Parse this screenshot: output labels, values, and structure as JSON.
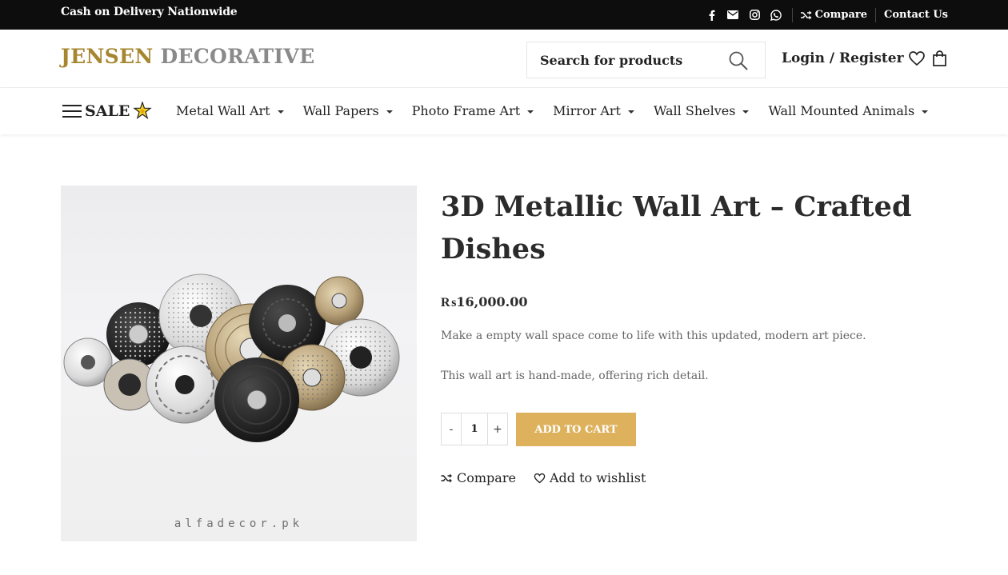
{
  "topbar": {
    "promo": "Cash on Delivery Nationwide",
    "social_icons": [
      "facebook-icon",
      "envelope-icon",
      "instagram-icon",
      "whatsapp-icon"
    ],
    "compare_label": "Compare",
    "contact_label": "Contact Us"
  },
  "header": {
    "logo_part1": "JENSEN",
    "logo_part2": "DECORATIVE",
    "search_placeholder": "Search for products",
    "login_label": "Login / Register"
  },
  "nav": {
    "sale_label": "SALE",
    "items": [
      {
        "label": "Metal Wall Art"
      },
      {
        "label": "Wall Papers"
      },
      {
        "label": "Photo Frame Art"
      },
      {
        "label": "Mirror Art"
      },
      {
        "label": "Wall Shelves"
      },
      {
        "label": "Wall Mounted Animals"
      }
    ]
  },
  "product": {
    "title": "3D Metallic Wall Art – Crafted Dishes",
    "price": "₨16,000.00",
    "desc1": "Make a empty wall space come to life with this updated, modern art piece.",
    "desc2": "This wall art is hand-made, offering rich detail.",
    "image_watermark": "alfadecor.pk",
    "qty_minus": "-",
    "qty_value": "1",
    "qty_plus": "+",
    "add_to_cart": "ADD TO CART",
    "compare_label": "Compare",
    "wishlist_label": "Add to wishlist"
  },
  "colors": {
    "accent": "#deb15c",
    "logo_gold": "#a6862f",
    "logo_gray": "#8a8a8a",
    "topbar_bg": "#0d0d0d"
  }
}
